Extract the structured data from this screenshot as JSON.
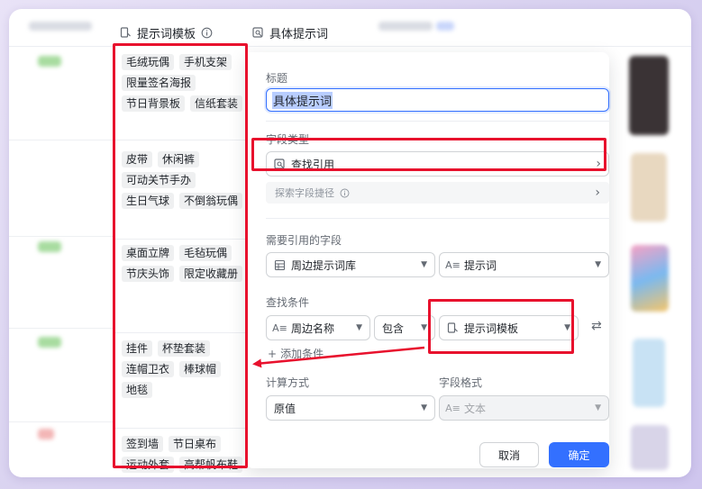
{
  "columns": {
    "template": {
      "label": "提示词模板"
    },
    "specific": {
      "label": "具体提示词"
    }
  },
  "template_cells": [
    {
      "rows": [
        [
          "毛绒玩偶",
          "手机支架"
        ],
        [
          "限量签名海报"
        ],
        [
          "节日背景板",
          "信纸套装"
        ]
      ]
    },
    {
      "rows": [
        [
          "皮带",
          "休闲裤"
        ],
        [
          "可动关节手办"
        ],
        [
          "生日气球",
          "不倒翁玩偶"
        ]
      ]
    },
    {
      "rows": [
        [
          "桌面立牌",
          "毛毡玩偶"
        ],
        [
          "节庆头饰",
          "限定收藏册"
        ]
      ]
    },
    {
      "rows": [
        [
          "挂件",
          "杯垫套装"
        ],
        [
          "连帽卫衣",
          "棒球帽"
        ],
        [
          "地毯"
        ]
      ]
    },
    {
      "rows": [
        [
          "签到墙",
          "节日桌布"
        ],
        [
          "运动外套",
          "高帮帆布鞋"
        ]
      ]
    }
  ],
  "panel": {
    "title_label": "标题",
    "title_value": "具体提示词",
    "field_type_label": "字段类型",
    "field_type_value": "查找引用",
    "hint_text": "探索字段捷径",
    "ref_fields_label": "需要引用的字段",
    "ref_table": "周边提示词库",
    "ref_field": "提示词",
    "conditions_label": "查找条件",
    "cond_field": "周边名称",
    "cond_op": "包含",
    "cond_value": "提示词模板",
    "add_condition": "添加条件",
    "calc_label": "计算方式",
    "calc_value": "原值",
    "format_label": "字段格式",
    "format_value": "文本",
    "cancel": "取消",
    "confirm": "确定"
  },
  "colors": {
    "accent": "#3370ff",
    "highlight": "#e8112d",
    "chip_bg": "#eff0f1"
  }
}
